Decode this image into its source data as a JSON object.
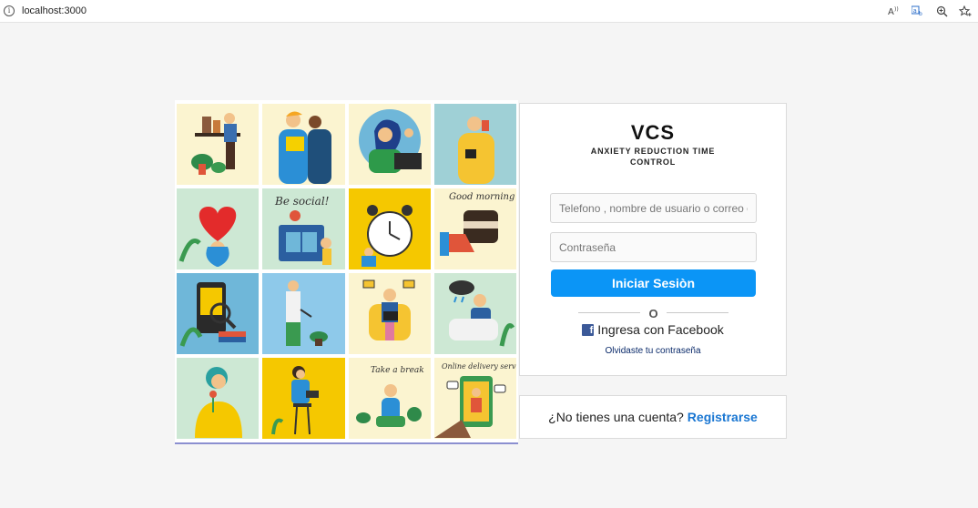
{
  "browser": {
    "url": "localhost:3000",
    "info_glyph": "i",
    "icons": [
      "read-aloud-icon",
      "translate-icon",
      "zoom-icon",
      "favorites-icon"
    ]
  },
  "brand": {
    "logo": "VCS",
    "tagline": "ANXIETY REDUCTION TIME CONTROL"
  },
  "login": {
    "user_placeholder": "Telefono , nombre de usuario o correo electronico",
    "password_placeholder": "Contraseña",
    "submit_label": "Iniciar Sesiòn",
    "divider_text": "O",
    "facebook_label": "Ingresa con Facebook",
    "forgot_label": "Olvidaste tu contraseña"
  },
  "signup": {
    "prompt": "¿No tienes una cuenta?",
    "link_label": "Registrarse"
  },
  "collage": {
    "tile_texts": [
      "Be social!",
      "Good morning",
      "Take a break",
      "Online delivery service"
    ]
  },
  "colors": {
    "primary_button": "#0b95f6",
    "signup_link": "#1976d2",
    "facebook": "#3b5998"
  }
}
